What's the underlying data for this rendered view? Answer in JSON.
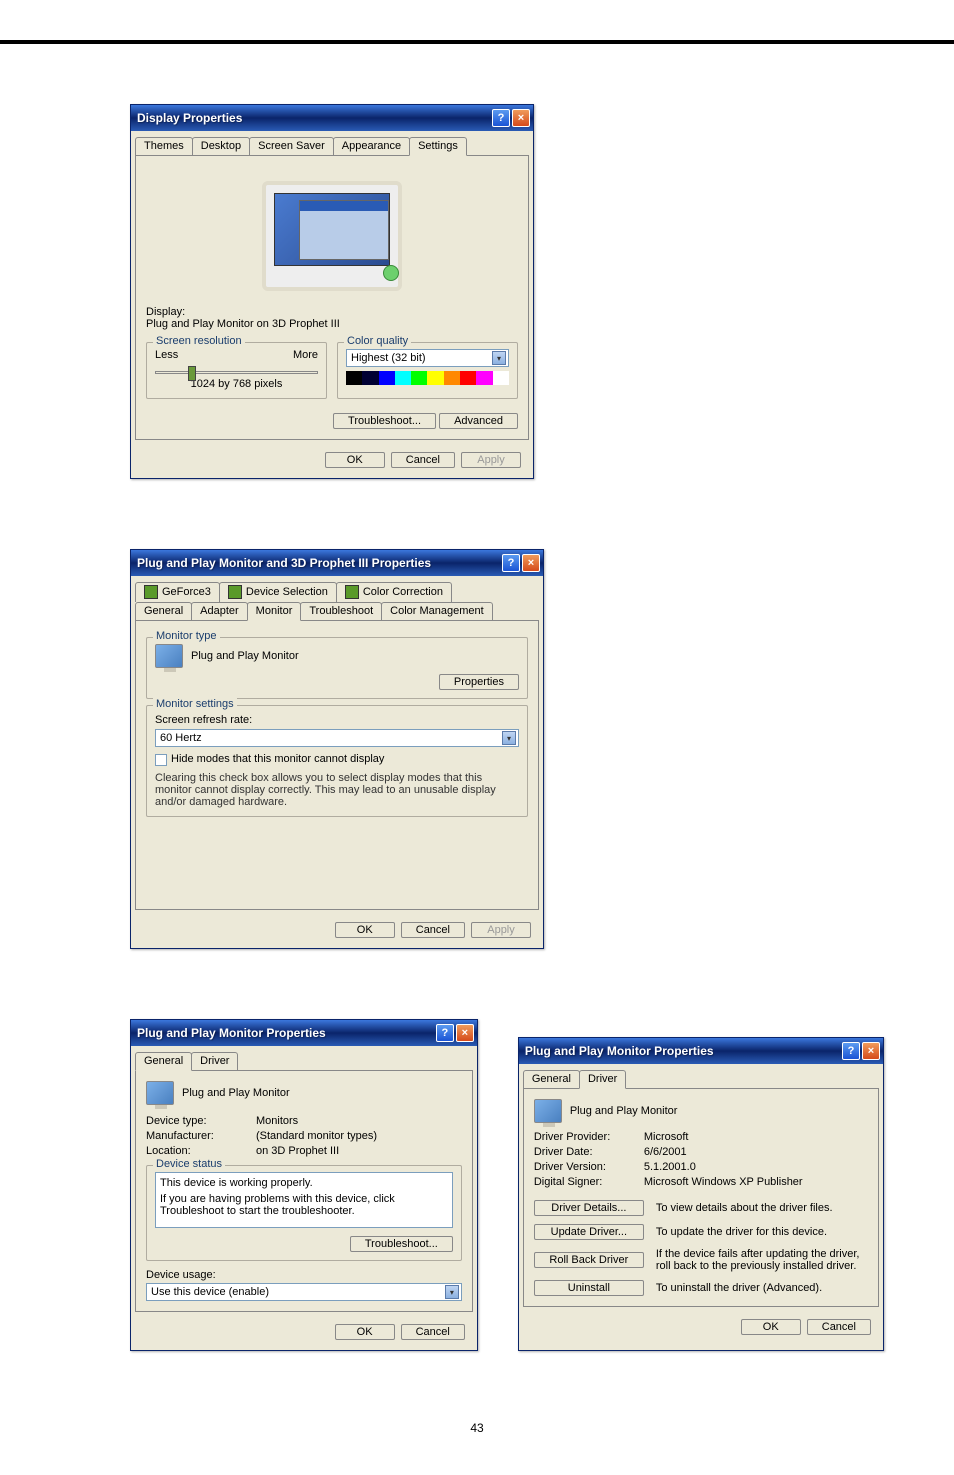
{
  "page_number": "43",
  "display_props": {
    "title": "Display Properties",
    "tabs": [
      "Themes",
      "Desktop",
      "Screen Saver",
      "Appearance",
      "Settings"
    ],
    "active_tab_idx": 4,
    "display_label": "Display:",
    "display_value": "Plug and Play Monitor on 3D Prophet III",
    "group_res_title": "Screen resolution",
    "less": "Less",
    "more": "More",
    "resolution_value": "1024 by 768 pixels",
    "group_color_title": "Color quality",
    "color_value": "Highest (32 bit)",
    "troubleshoot_btn": "Troubleshoot...",
    "advanced_btn": "Advanced",
    "ok": "OK",
    "cancel": "Cancel",
    "apply": "Apply"
  },
  "monitor_props": {
    "title": "Plug and Play Monitor and 3D Prophet III Properties",
    "tabs_top": [
      "GeForce3",
      "Device Selection",
      "Color Correction"
    ],
    "tabs_bottom": [
      "General",
      "Adapter",
      "Monitor",
      "Troubleshoot",
      "Color Management"
    ],
    "active_tab": "Monitor",
    "group_type": "Monitor type",
    "monitor_name": "Plug and Play Monitor",
    "properties_btn": "Properties",
    "group_settings": "Monitor settings",
    "refresh_label": "Screen refresh rate:",
    "refresh_value": "60 Hertz",
    "checkbox_label": "Hide modes that this monitor cannot display",
    "checkbox_desc": "Clearing this check box allows you to select display modes that this monitor cannot display correctly. This may lead to an unusable display and/or damaged hardware.",
    "ok": "OK",
    "cancel": "Cancel",
    "apply": "Apply"
  },
  "dev_props_general": {
    "title": "Plug and Play Monitor Properties",
    "tabs": [
      "General",
      "Driver"
    ],
    "active_idx": 0,
    "monitor_name": "Plug and Play Monitor",
    "device_type_k": "Device type:",
    "device_type_v": "Monitors",
    "manufacturer_k": "Manufacturer:",
    "manufacturer_v": "(Standard monitor types)",
    "location_k": "Location:",
    "location_v": "on 3D Prophet III",
    "status_group": "Device status",
    "status_text": "This device is working properly.",
    "status_help": "If you are having problems with this device, click Troubleshoot to start the troubleshooter.",
    "troubleshoot_btn": "Troubleshoot...",
    "usage_label": "Device usage:",
    "usage_value": "Use this device (enable)",
    "ok": "OK",
    "cancel": "Cancel"
  },
  "dev_props_driver": {
    "title": "Plug and Play Monitor Properties",
    "tabs": [
      "General",
      "Driver"
    ],
    "active_idx": 1,
    "monitor_name": "Plug and Play Monitor",
    "provider_k": "Driver Provider:",
    "provider_v": "Microsoft",
    "date_k": "Driver Date:",
    "date_v": "6/6/2001",
    "version_k": "Driver Version:",
    "version_v": "5.1.2001.0",
    "signer_k": "Digital Signer:",
    "signer_v": "Microsoft Windows XP Publisher",
    "details_btn": "Driver Details...",
    "details_desc": "To view details about the driver files.",
    "update_btn": "Update Driver...",
    "update_desc": "To update the driver for this device.",
    "rollback_btn": "Roll Back Driver",
    "rollback_desc": "If the device fails after updating the driver, roll back to the previously installed driver.",
    "uninstall_btn": "Uninstall",
    "uninstall_desc": "To uninstall the driver (Advanced).",
    "ok": "OK",
    "cancel": "Cancel"
  }
}
